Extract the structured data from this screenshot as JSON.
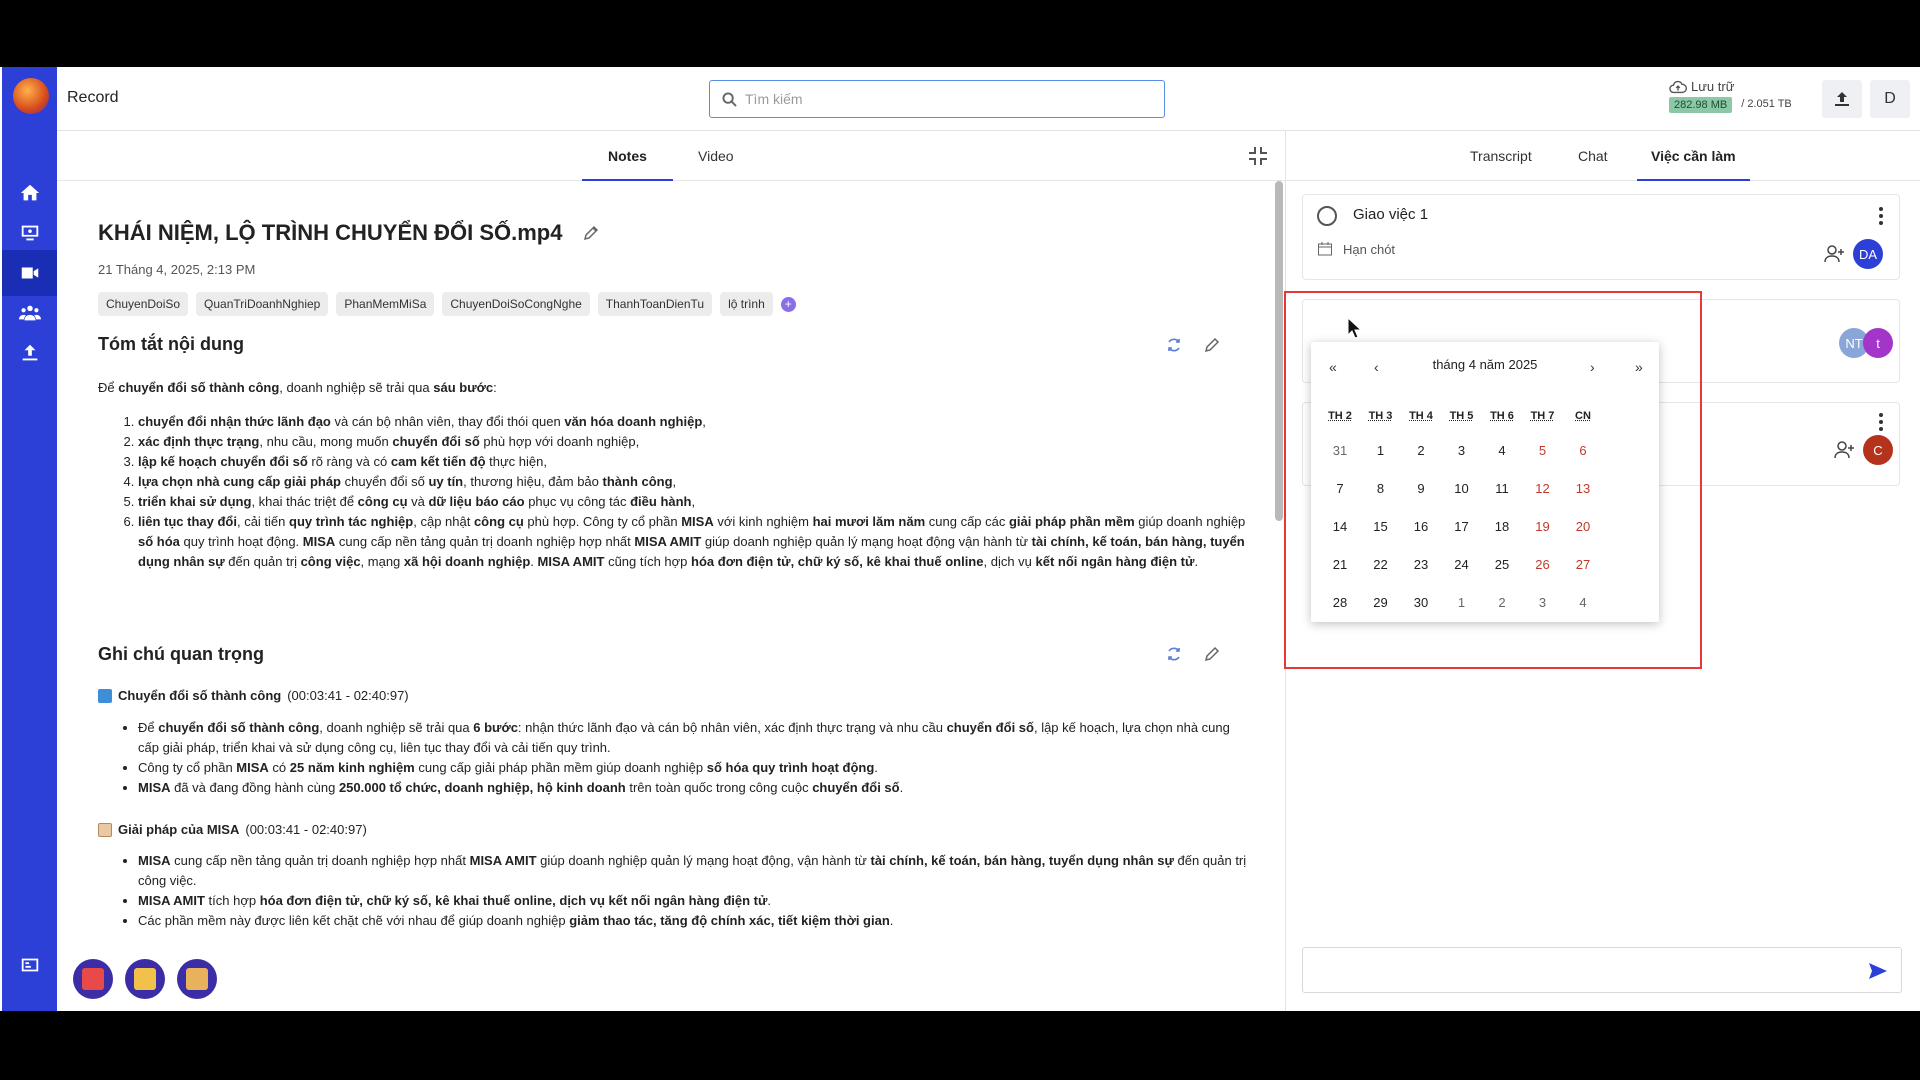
{
  "app": {
    "title": "Record"
  },
  "search": {
    "placeholder": "Tìm kiếm"
  },
  "storage": {
    "label": "Lưu trữ",
    "used": "282.98 MB",
    "total": "/ 2.051 TB"
  },
  "user": {
    "initial": "D"
  },
  "notes_tabs": [
    "Notes",
    "Video"
  ],
  "side_tabs": [
    "Transcript",
    "Chat",
    "Việc cần làm"
  ],
  "doc": {
    "title": "KHÁI NIỆM, LỘ TRÌNH CHUYỂN ĐỔI SỐ.mp4",
    "date": "21 Tháng 4, 2025, 2:13 PM",
    "tags": [
      "ChuyenDoiSo",
      "QuanTriDoanhNghiep",
      "PhanMemMiSa",
      "ChuyenDoiSoCongNghe",
      "ThanhToanDienTu",
      "lộ trình"
    ]
  },
  "summary": {
    "heading": "Tóm tắt nội dung",
    "intro": [
      "Để ",
      "chuyển đổi số thành công",
      ", doanh nghiệp sẽ trải qua ",
      "sáu bước",
      ":"
    ],
    "steps": [
      [
        [
          "chuyển đổi nhận thức lãnh đạo",
          1
        ],
        [
          " và cán bộ nhân viên, thay đổi thói quen ",
          0
        ],
        [
          "văn hóa doanh nghiệp",
          1
        ],
        [
          ",",
          0
        ]
      ],
      [
        [
          "xác định thực trạng",
          1
        ],
        [
          ", nhu cầu, mong muốn ",
          0
        ],
        [
          "chuyển đổi số",
          1
        ],
        [
          " phù hợp với doanh nghiệp,",
          0
        ]
      ],
      [
        [
          "lập kế hoạch chuyển đổi số",
          1
        ],
        [
          " rõ ràng và có ",
          0
        ],
        [
          "cam kết tiến độ",
          1
        ],
        [
          " thực hiện,",
          0
        ]
      ],
      [
        [
          "lựa chọn nhà cung cấp giải pháp",
          1
        ],
        [
          " chuyển đổi số ",
          0
        ],
        [
          "uy tín",
          1
        ],
        [
          ", thương hiệu, đảm bảo ",
          0
        ],
        [
          "thành công",
          1
        ],
        [
          ",",
          0
        ]
      ],
      [
        [
          "triển khai sử dụng",
          1
        ],
        [
          ", khai thác triệt để ",
          0
        ],
        [
          "công cụ",
          1
        ],
        [
          " và ",
          0
        ],
        [
          "dữ liệu báo cáo",
          1
        ],
        [
          " phục vụ công tác ",
          0
        ],
        [
          "điều hành",
          1
        ],
        [
          ",",
          0
        ]
      ],
      [
        [
          "liên tục thay đổi",
          1
        ],
        [
          ", cải tiến ",
          0
        ],
        [
          "quy trình tác nghiệp",
          1
        ],
        [
          ", cập nhật ",
          0
        ],
        [
          "công cụ",
          1
        ],
        [
          " phù hợp. Công ty cổ phần ",
          0
        ],
        [
          "MISA",
          1
        ],
        [
          " với kinh nghiệm ",
          0
        ],
        [
          "hai mươi lăm năm",
          1
        ],
        [
          " cung cấp các ",
          0
        ],
        [
          "giải pháp phần mềm",
          1
        ],
        [
          " giúp doanh nghiệp ",
          0
        ],
        [
          "số hóa",
          1
        ],
        [
          " quy trình hoạt động. ",
          0
        ],
        [
          "MISA",
          1
        ],
        [
          " cung cấp nền tảng quản trị doanh nghiệp hợp nhất ",
          0
        ],
        [
          "MISA AMIT",
          1
        ],
        [
          " giúp doanh nghiệp quản lý mạng hoạt động vận hành từ ",
          0
        ],
        [
          "tài chính, kế toán, bán hàng, tuyển dụng nhân sự",
          1
        ],
        [
          " đến quản trị ",
          0
        ],
        [
          "công việc",
          1
        ],
        [
          ", mạng ",
          0
        ],
        [
          "xã hội doanh nghiệp",
          1
        ],
        [
          ". ",
          0
        ],
        [
          "MISA AMIT",
          1
        ],
        [
          " cũng tích hợp ",
          0
        ],
        [
          "hóa đơn điện tử, chữ ký số, kê khai thuế online",
          1
        ],
        [
          ", dịch vụ ",
          0
        ],
        [
          "kết nối ngân hàng điện tử",
          1
        ],
        [
          ".",
          0
        ]
      ]
    ]
  },
  "important": {
    "heading": "Ghi chú quan trọng",
    "notes": [
      {
        "title": "Chuyển đổi số thành công",
        "time": " (00:03:41 - 02:40:97)",
        "bullets": [
          [
            [
              "Để ",
              0
            ],
            [
              "chuyển đổi số thành công",
              1
            ],
            [
              ", doanh nghiệp sẽ trải qua ",
              0
            ],
            [
              "6 bước",
              1
            ],
            [
              ": nhận thức lãnh đạo và cán bộ nhân viên, xác định thực trạng và nhu cầu ",
              0
            ],
            [
              "chuyển đổi số",
              1
            ],
            [
              ", lập kế hoạch, lựa chọn nhà cung cấp giải pháp, triển khai và sử dụng công cụ, liên tục thay đổi và cải tiến quy trình.",
              0
            ]
          ],
          [
            [
              "Công ty cổ phần ",
              0
            ],
            [
              "MISA",
              1
            ],
            [
              " có ",
              0
            ],
            [
              "25 năm kinh nghiệm",
              1
            ],
            [
              " cung cấp giải pháp phần mềm giúp doanh nghiệp ",
              0
            ],
            [
              "số hóa quy trình hoạt động",
              1
            ],
            [
              ".",
              0
            ]
          ],
          [
            [
              "MISA",
              1
            ],
            [
              " đã và đang đồng hành cùng ",
              0
            ],
            [
              "250.000 tổ chức, doanh nghiệp, hộ kinh doanh",
              1
            ],
            [
              " trên toàn quốc trong công cuộc ",
              0
            ],
            [
              "chuyển đổi số",
              1
            ],
            [
              ".",
              0
            ]
          ]
        ]
      },
      {
        "title": "Giải pháp của MISA",
        "time": " (00:03:41 - 02:40:97)",
        "bullets": [
          [
            [
              "MISA",
              1
            ],
            [
              " cung cấp nền tảng quản trị doanh nghiệp hợp nhất ",
              0
            ],
            [
              "MISA AMIT",
              1
            ],
            [
              " giúp doanh nghiệp quản lý mạng hoạt động, vận hành từ ",
              0
            ],
            [
              "tài chính, kế toán, bán hàng, tuyển dụng nhân sự",
              1
            ],
            [
              " đến quản trị công việc.",
              0
            ]
          ],
          [
            [
              "MISA AMIT",
              1
            ],
            [
              " tích hợp ",
              0
            ],
            [
              "hóa đơn điện tử, chữ ký số, kê khai thuế online, dịch vụ kết nối ngân hàng điện tử",
              1
            ],
            [
              ".",
              0
            ]
          ],
          [
            [
              "Các phần mềm này được liên kết chặt chẽ với nhau để giúp doanh nghiệp ",
              0
            ],
            [
              "giảm thao tác, tăng độ chính xác, tiết kiệm thời gian",
              1
            ],
            [
              ".",
              0
            ]
          ]
        ]
      }
    ]
  },
  "tasks": [
    {
      "title": "Giao việc 1",
      "deadline_label": "Hạn chót",
      "assignees": [
        "DA"
      ]
    },
    {
      "title": "",
      "assignees": [
        "NT",
        "t"
      ]
    },
    {
      "title": "",
      "assignees": [
        "C"
      ]
    }
  ],
  "datepicker": {
    "month_label": "tháng 4 năm 2025",
    "nav": [
      "«",
      "‹",
      "›",
      "»"
    ],
    "weekdays": [
      "TH 2",
      "TH 3",
      "TH 4",
      "TH 5",
      "TH 6",
      "TH 7",
      "CN"
    ],
    "weeks": [
      [
        "31",
        "1",
        "2",
        "3",
        "4",
        "5",
        "6"
      ],
      [
        "7",
        "8",
        "9",
        "10",
        "11",
        "12",
        "13"
      ],
      [
        "14",
        "15",
        "16",
        "17",
        "18",
        "19",
        "20"
      ],
      [
        "21",
        "22",
        "23",
        "24",
        "25",
        "26",
        "27"
      ],
      [
        "28",
        "29",
        "30",
        "1",
        "2",
        "3",
        "4"
      ]
    ]
  },
  "colors": {
    "brand": "#2c3fd6",
    "highlight": "#e53935",
    "weekend": "#c0392b"
  }
}
